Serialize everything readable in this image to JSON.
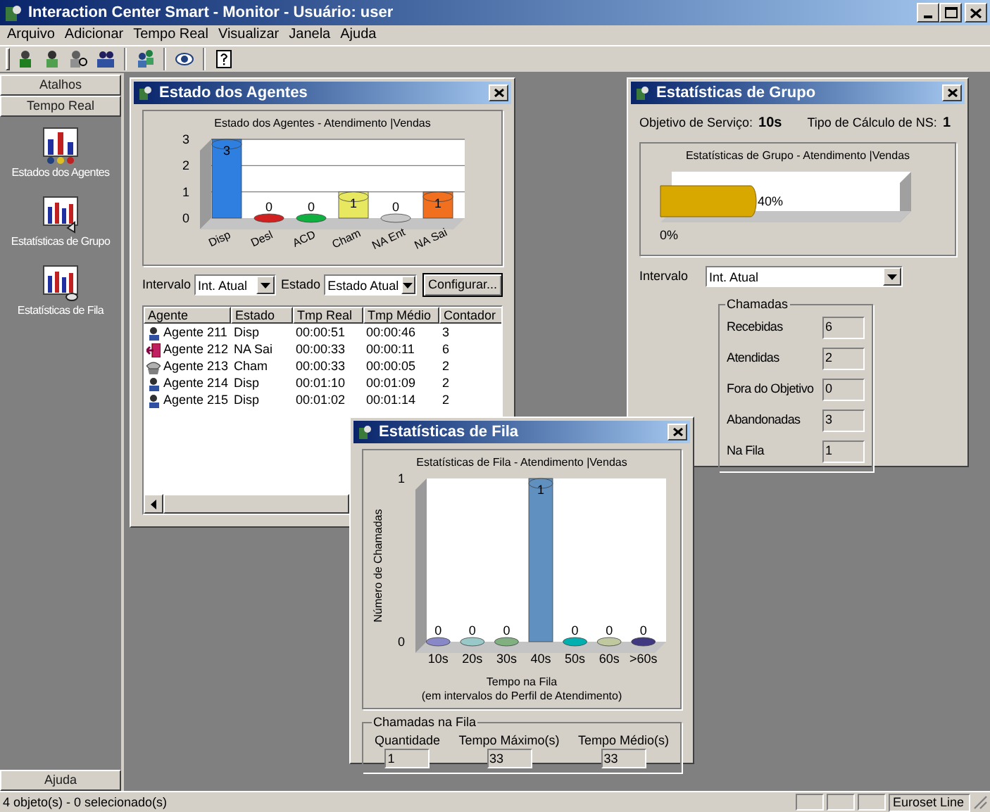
{
  "app": {
    "title": "Interaction Center Smart - Monitor - Usuário: user"
  },
  "menu": [
    "Arquivo",
    "Adicionar",
    "Tempo Real",
    "Visualizar",
    "Janela",
    "Ajuda"
  ],
  "sidebar": {
    "sections": [
      "Atalhos",
      "Tempo Real"
    ],
    "items": [
      {
        "label": "Estados dos Agentes"
      },
      {
        "label": "Estatísticas de Grupo"
      },
      {
        "label": "Estatísticas de Fila"
      }
    ],
    "footer": "Ajuda"
  },
  "agents_window": {
    "title": "Estado dos Agentes",
    "chart_data": {
      "type": "bar",
      "title": "Estado dos Agentes - Atendimento |Vendas",
      "categories": [
        "Disp",
        "Desl",
        "ACD",
        "Cham",
        "NA Ent",
        "NA Sai"
      ],
      "stacked": true,
      "series": [
        {
          "color": "#2f7fe0",
          "values": [
            3,
            null,
            null,
            null,
            null,
            null
          ]
        },
        {
          "color": "#d02020",
          "values": [
            null,
            0,
            null,
            null,
            null,
            null
          ]
        },
        {
          "color": "#10b040",
          "values": [
            null,
            null,
            0,
            null,
            null,
            null
          ]
        },
        {
          "color": "#e8e860",
          "values": [
            null,
            null,
            null,
            1,
            null,
            null
          ]
        },
        {
          "color": "#c8c8c8",
          "values": [
            null,
            null,
            null,
            null,
            0,
            null
          ]
        },
        {
          "color": "#f07020",
          "values": [
            null,
            null,
            null,
            null,
            null,
            1
          ]
        }
      ],
      "ylim": [
        0,
        3
      ],
      "yticks": [
        0,
        1,
        2,
        3
      ],
      "data_labels": true
    },
    "interval_label": "Intervalo",
    "interval_value": "Int. Atual",
    "state_label": "Estado",
    "state_value": "Estado Atual",
    "configure_button": "Configurar...",
    "table": {
      "columns": [
        "Agente",
        "Estado",
        "Tmp Real",
        "Tmp Médio",
        "Contador"
      ],
      "rows": [
        {
          "kind": "agent",
          "cells": [
            "Agente 211",
            "Disp",
            "00:00:51",
            "00:00:46",
            "3"
          ]
        },
        {
          "kind": "logout",
          "cells": [
            "Agente 212",
            "NA Sai",
            "00:00:33",
            "00:00:11",
            "6"
          ]
        },
        {
          "kind": "phone",
          "cells": [
            "Agente 213",
            "Cham",
            "00:00:33",
            "00:00:05",
            "2"
          ]
        },
        {
          "kind": "agent",
          "cells": [
            "Agente 214",
            "Disp",
            "00:01:10",
            "00:01:09",
            "2"
          ]
        },
        {
          "kind": "agent",
          "cells": [
            "Agente 215",
            "Disp",
            "00:01:02",
            "00:01:14",
            "2"
          ]
        }
      ]
    }
  },
  "group_window": {
    "title": "Estatísticas de Grupo",
    "objective_label": "Objetivo de Serviço:",
    "objective_value": "10s",
    "calc_label": "Tipo de Cálculo de NS:",
    "calc_value": "1",
    "service_meter": {
      "title": "Estatísticas de Grupo - Atendimento |Vendas",
      "level": 0.4,
      "reading": "40%",
      "scale_start": "0%"
    },
    "interval_label": "Intervalo",
    "interval_value": "Int. Atual",
    "calls": {
      "title": "Chamadas",
      "fields": [
        {
          "label": "Recebidas",
          "value": "6"
        },
        {
          "label": "Atendidas",
          "value": "2"
        },
        {
          "label": "Fora do Objetivo",
          "value": "0"
        },
        {
          "label": "Abandonadas",
          "value": "3"
        },
        {
          "label": "Na Fila",
          "value": "1"
        }
      ]
    }
  },
  "queue_window": {
    "title": "Estatísticas de Fila",
    "chart_data": {
      "type": "bar",
      "title": "Estatísticas de Fila - Atendimento |Vendas",
      "xlabel": "Tempo na Fila",
      "ylabel": "Número de Chamadas",
      "categories": [
        "10s",
        "20s",
        "30s",
        "40s",
        "50s",
        "60s",
        ">60s"
      ],
      "stacked": true,
      "series": [
        {
          "color": "#8888c8",
          "values": [
            0,
            null,
            null,
            null,
            null,
            null,
            null
          ]
        },
        {
          "color": "#98c8c8",
          "values": [
            null,
            0,
            null,
            null,
            null,
            null,
            null
          ]
        },
        {
          "color": "#80b080",
          "values": [
            null,
            null,
            0,
            null,
            null,
            null,
            null
          ]
        },
        {
          "color": "#6090c0",
          "values": [
            null,
            null,
            null,
            1,
            null,
            null,
            null
          ]
        },
        {
          "color": "#00b0b0",
          "values": [
            null,
            null,
            null,
            null,
            0,
            null,
            null
          ]
        },
        {
          "color": "#c0c8a0",
          "values": [
            null,
            null,
            null,
            null,
            null,
            0,
            null
          ]
        },
        {
          "color": "#403880",
          "values": [
            null,
            null,
            null,
            null,
            null,
            null,
            0
          ]
        }
      ],
      "ylim": [
        0,
        1
      ],
      "yticks": [
        0,
        1
      ],
      "data_labels": true
    },
    "xlabel_note": "(em intervalos do Perfil de Atendimento)",
    "queue": {
      "title": "Chamadas na Fila",
      "fields": [
        {
          "label": "Quantidade",
          "value": "1"
        },
        {
          "label": "Tempo Máximo(s)",
          "value": "33"
        },
        {
          "label": "Tempo Médio(s)",
          "value": "33"
        }
      ]
    }
  },
  "status_bar": {
    "text": "4 objeto(s) - 0 selecionado(s)",
    "panel": "Euroset Line"
  }
}
